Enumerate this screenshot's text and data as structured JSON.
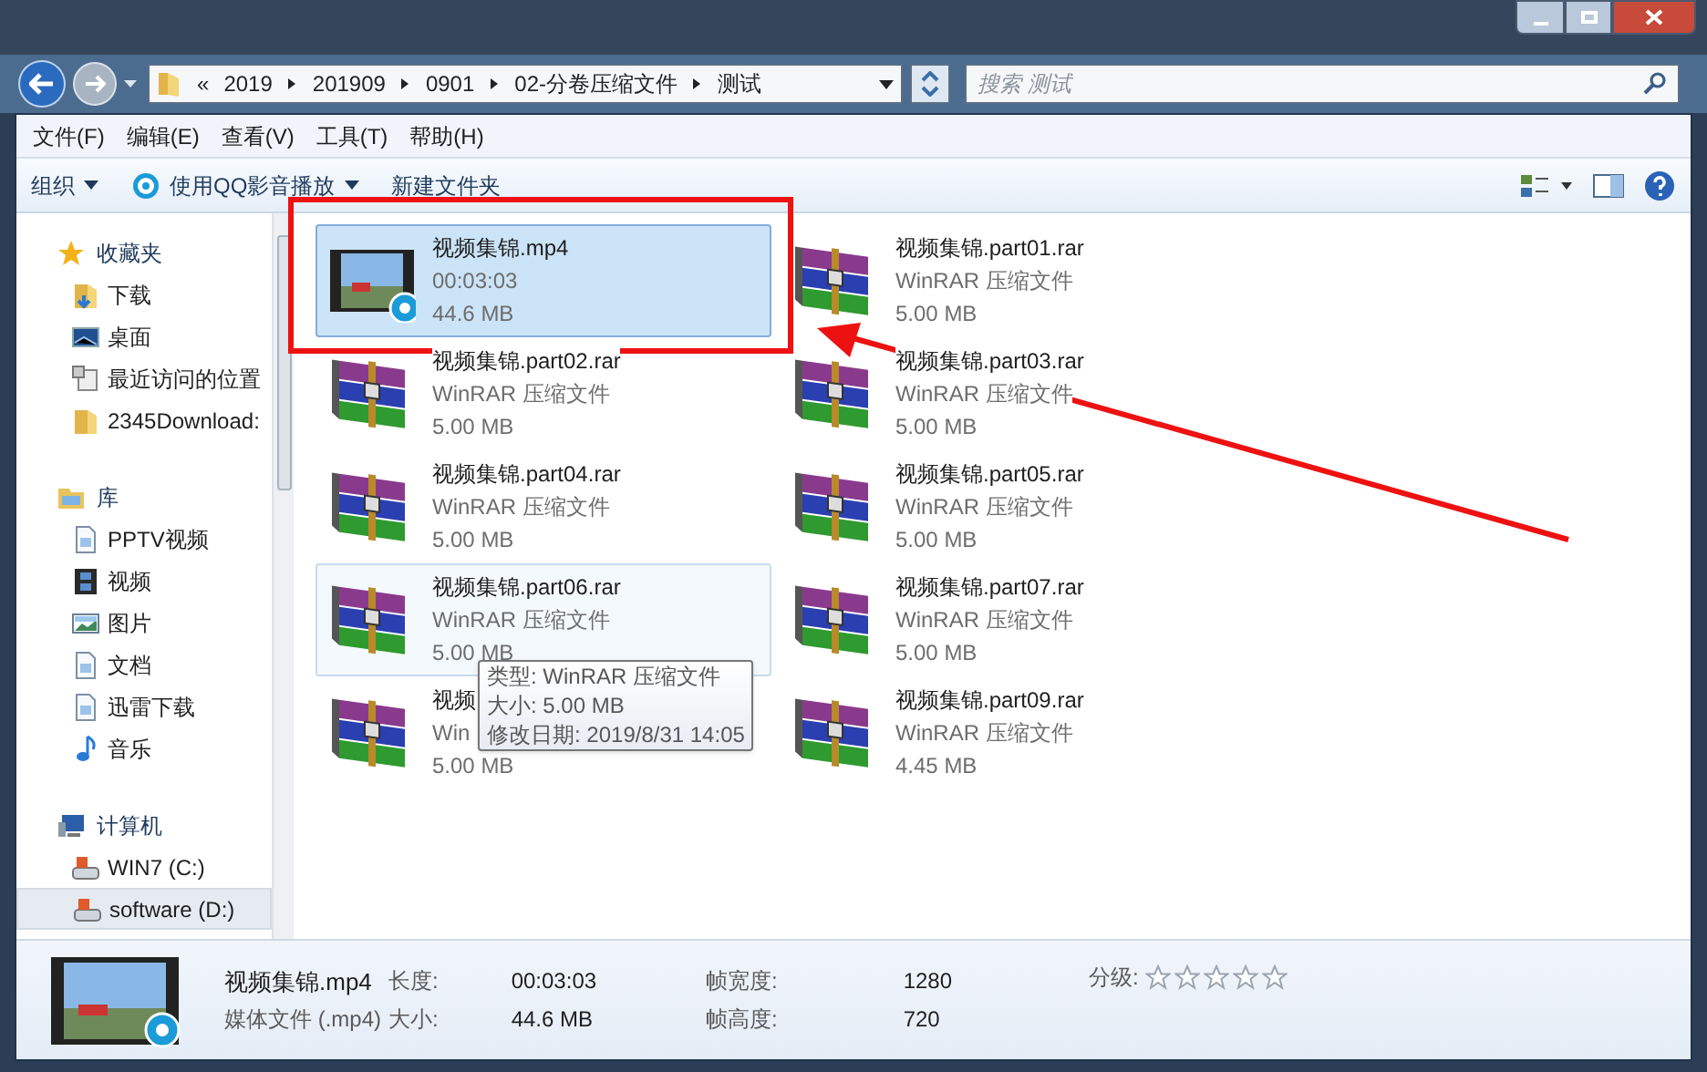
{
  "breadcrumbs": [
    "2019",
    "201909",
    "0901",
    "02-分卷压缩文件",
    "测试"
  ],
  "overflow": "«",
  "search": {
    "placeholder": "搜索 测试"
  },
  "menu": [
    "文件(F)",
    "编辑(E)",
    "查看(V)",
    "工具(T)",
    "帮助(H)"
  ],
  "toolbar": [
    {
      "label": "组织",
      "kind": "menu"
    },
    {
      "label": "使用QQ影音播放",
      "kind": "app"
    },
    {
      "label": "新建文件夹",
      "kind": "plain"
    }
  ],
  "sidebar": [
    {
      "label": "收藏夹",
      "kind": "star",
      "children": [
        {
          "label": "下载",
          "kind": "download"
        },
        {
          "label": "桌面",
          "kind": "desktop"
        },
        {
          "label": "最近访问的位置",
          "kind": "recent"
        },
        {
          "label": "2345Download:",
          "kind": "folder"
        }
      ]
    },
    {
      "label": "库",
      "kind": "library",
      "children": [
        {
          "label": "PPTV视频",
          "kind": "doc"
        },
        {
          "label": "视频",
          "kind": "video"
        },
        {
          "label": "图片",
          "kind": "picture"
        },
        {
          "label": "文档",
          "kind": "doc"
        },
        {
          "label": "迅雷下载",
          "kind": "doc"
        },
        {
          "label": "音乐",
          "kind": "music"
        }
      ]
    },
    {
      "label": "计算机",
      "kind": "computer",
      "children": [
        {
          "label": "WIN7 (C:)",
          "kind": "drive",
          "selected": false
        },
        {
          "label": "software (D:)",
          "kind": "drive",
          "selected": true
        }
      ]
    }
  ],
  "files": [
    {
      "name": "视频集锦.mp4",
      "line2": "00:03:03",
      "size": "44.6 MB",
      "kind": "video",
      "selected": true,
      "hovered": false
    },
    {
      "name": "视频集锦.part01.rar",
      "line2": "WinRAR 压缩文件",
      "size": "5.00 MB",
      "kind": "rar",
      "selected": false,
      "hovered": false
    },
    {
      "name": "视频集锦.part02.rar",
      "line2": "WinRAR 压缩文件",
      "size": "5.00 MB",
      "kind": "rar",
      "selected": false,
      "hovered": false
    },
    {
      "name": "视频集锦.part03.rar",
      "line2": "WinRAR 压缩文件",
      "size": "5.00 MB",
      "kind": "rar",
      "selected": false,
      "hovered": false
    },
    {
      "name": "视频集锦.part04.rar",
      "line2": "WinRAR 压缩文件",
      "size": "5.00 MB",
      "kind": "rar",
      "selected": false,
      "hovered": false
    },
    {
      "name": "视频集锦.part05.rar",
      "line2": "WinRAR 压缩文件",
      "size": "5.00 MB",
      "kind": "rar",
      "selected": false,
      "hovered": false
    },
    {
      "name": "视频集锦.part06.rar",
      "line2": "WinRAR 压缩文件",
      "size": "5.00 MB",
      "kind": "rar",
      "selected": false,
      "hovered": true
    },
    {
      "name": "视频集锦.part07.rar",
      "line2": "WinRAR 压缩文件",
      "size": "5.00 MB",
      "kind": "rar",
      "selected": false,
      "hovered": false
    },
    {
      "name": "视频",
      "line2": "Win",
      "size": "5.00 MB",
      "kind": "rar",
      "selected": false,
      "hovered": false
    },
    {
      "name": "视频集锦.part09.rar",
      "line2": "WinRAR 压缩文件",
      "size": "4.45 MB",
      "kind": "rar",
      "selected": false,
      "hovered": false
    }
  ],
  "tooltip": [
    "类型: WinRAR 压缩文件",
    "大小: 5.00 MB",
    "修改日期: 2019/8/31 14:05"
  ],
  "details": {
    "name": "视频集锦.mp4",
    "type": "媒体文件 (.mp4)",
    "fields": [
      [
        "长度:",
        "00:03:03"
      ],
      [
        "大小:",
        "44.6 MB"
      ],
      [
        "帧宽度:",
        "1280"
      ],
      [
        "帧高度:",
        "720"
      ]
    ],
    "rating_label": "分级:",
    "stars": 0
  }
}
